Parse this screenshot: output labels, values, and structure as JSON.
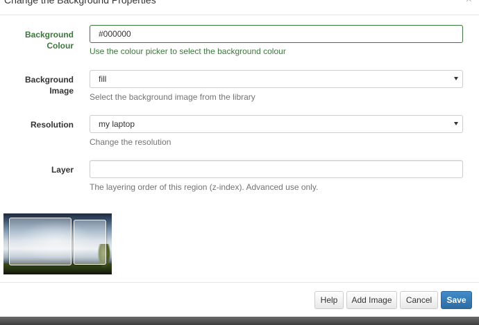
{
  "modal": {
    "title": "Change the Background Properties",
    "close_glyph": "×"
  },
  "fields": {
    "background_colour": {
      "label": "Background Colour",
      "value": "#000000",
      "help": "Use the colour picker to select the background colour"
    },
    "background_image": {
      "label": "Background Image",
      "selected": "fill",
      "help": "Select the background image from the library"
    },
    "resolution": {
      "label": "Resolution",
      "selected": "my laptop",
      "help": "Change the resolution"
    },
    "layer": {
      "label": "Layer",
      "value": "",
      "help": "The layering order of this region (z-index). Advanced use only."
    }
  },
  "footer": {
    "help_label": "Help",
    "add_image_label": "Add Image",
    "cancel_label": "Cancel",
    "save_label": "Save"
  },
  "colors": {
    "success": "#3c763d",
    "primary": "#428bca",
    "help_text": "#737373"
  }
}
